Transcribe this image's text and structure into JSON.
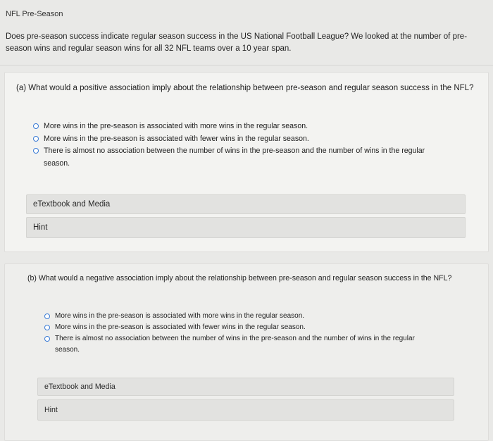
{
  "header": {
    "title": "NFL Pre-Season"
  },
  "intro": "Does pre-season success indicate regular season success in the US National Football League? We looked at the number of pre-season wins and regular season wins for all 32 NFL teams over a 10 year span.",
  "colors": {
    "background": "#e9e9e7",
    "card": "#f3f3f1",
    "panel": "#e2e2e0",
    "radio_accent": "#3a7bd5"
  },
  "part_a": {
    "question": "(a) What would a positive association imply about the relationship between pre-season and regular season success in the NFL?",
    "options": [
      "More wins in the pre-season is associated with more wins in the regular season.",
      "More wins in the pre-season is associated with fewer wins in the regular season.",
      "There is almost no association between the number of wins in the pre-season and the number of wins in the regular season."
    ],
    "etextbook_label": "eTextbook and Media",
    "hint_label": "Hint"
  },
  "part_b": {
    "question": "(b) What would a negative association imply about the relationship between pre-season and regular season success in the NFL?",
    "options": [
      "More wins in the pre-season is associated with more wins in the regular season.",
      "More wins in the pre-season is associated with fewer wins in the regular season.",
      "There is almost no association between the number of wins in the pre-season and the number of wins in the regular season."
    ],
    "etextbook_label": "eTextbook and Media",
    "hint_label": "Hint"
  }
}
